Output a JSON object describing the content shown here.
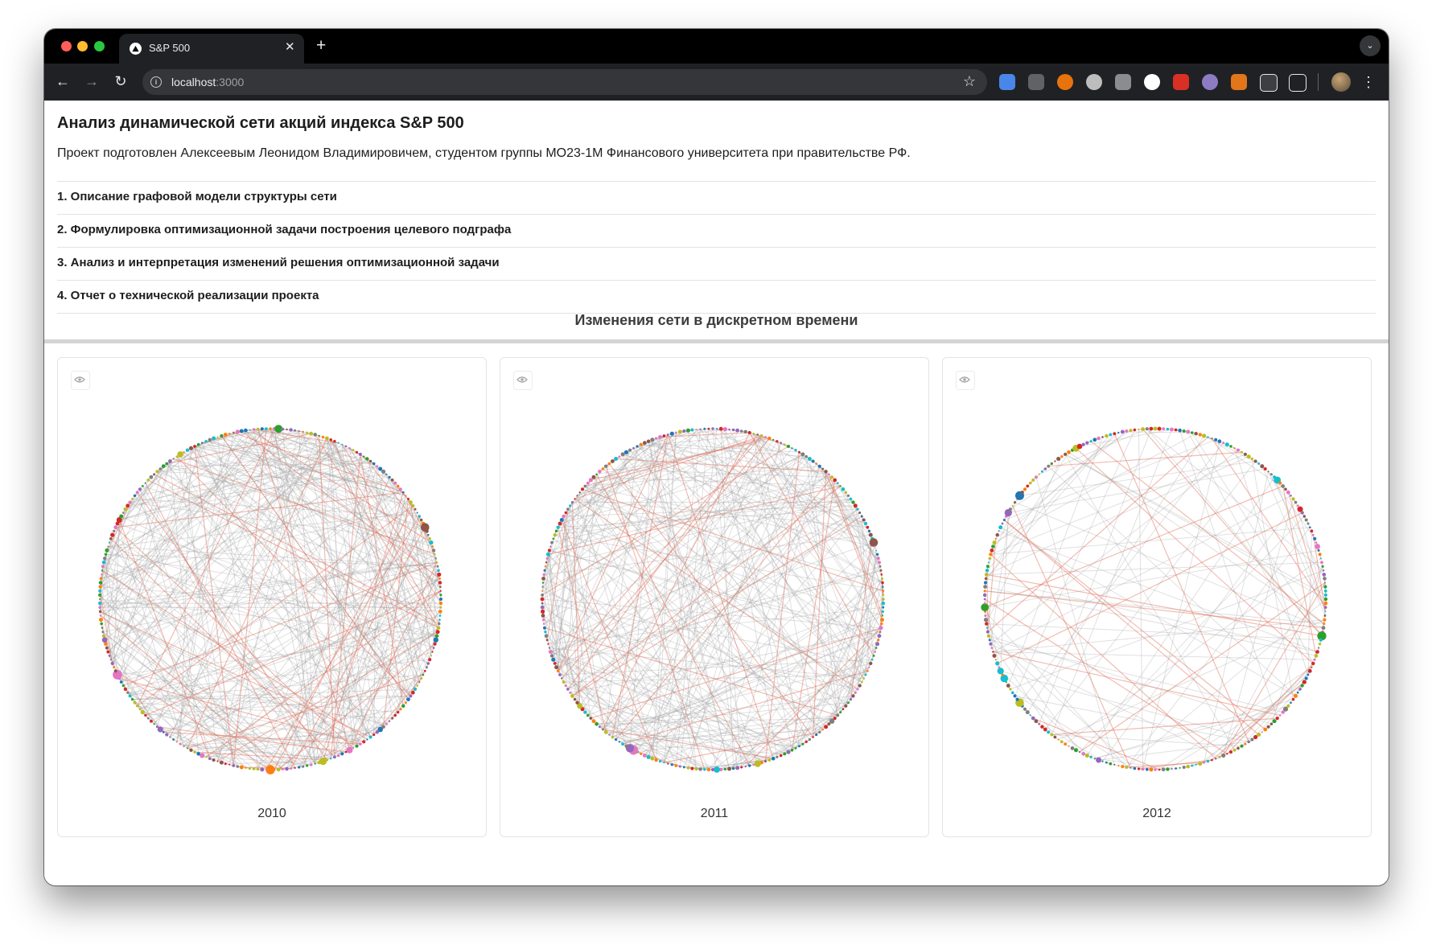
{
  "browser": {
    "tab_title": "S&P 500",
    "url_host": "localhost",
    "url_port": ":3000"
  },
  "page": {
    "title": "Анализ динамической сети акций индекса S&P 500",
    "author_note": "Проект подготовлен Алексеевым Леонидом Владимировичем, студентом группы МО23-1М Финансового университета при правительстве РФ.",
    "sections": [
      "1. Описание графовой модели структуры сети",
      "2. Формулировка оптимизационной задачи построения целевого подграфа",
      "3. Анализ и интерпретация изменений решения оптимизационной задачи",
      "4. Отчет о технической реализации проекта"
    ],
    "network_heading": "Изменения сети в дискретном времени"
  },
  "panels": [
    {
      "year": "2010",
      "gray_edges": 360,
      "red_edges": 60,
      "nodes": 260
    },
    {
      "year": "2011",
      "gray_edges": 320,
      "red_edges": 45,
      "nodes": 260
    },
    {
      "year": "2012",
      "gray_edges": 110,
      "red_edges": 30,
      "nodes": 260
    }
  ],
  "colors": {
    "edge_gray": "#9e9e9e",
    "edge_red": "#e06b55",
    "node_palette": [
      "#1f77b4",
      "#ff7f0e",
      "#2ca02c",
      "#d62728",
      "#9467bd",
      "#8c564b",
      "#e377c2",
      "#bcbd22",
      "#17becf",
      "#7f7f7f"
    ]
  }
}
